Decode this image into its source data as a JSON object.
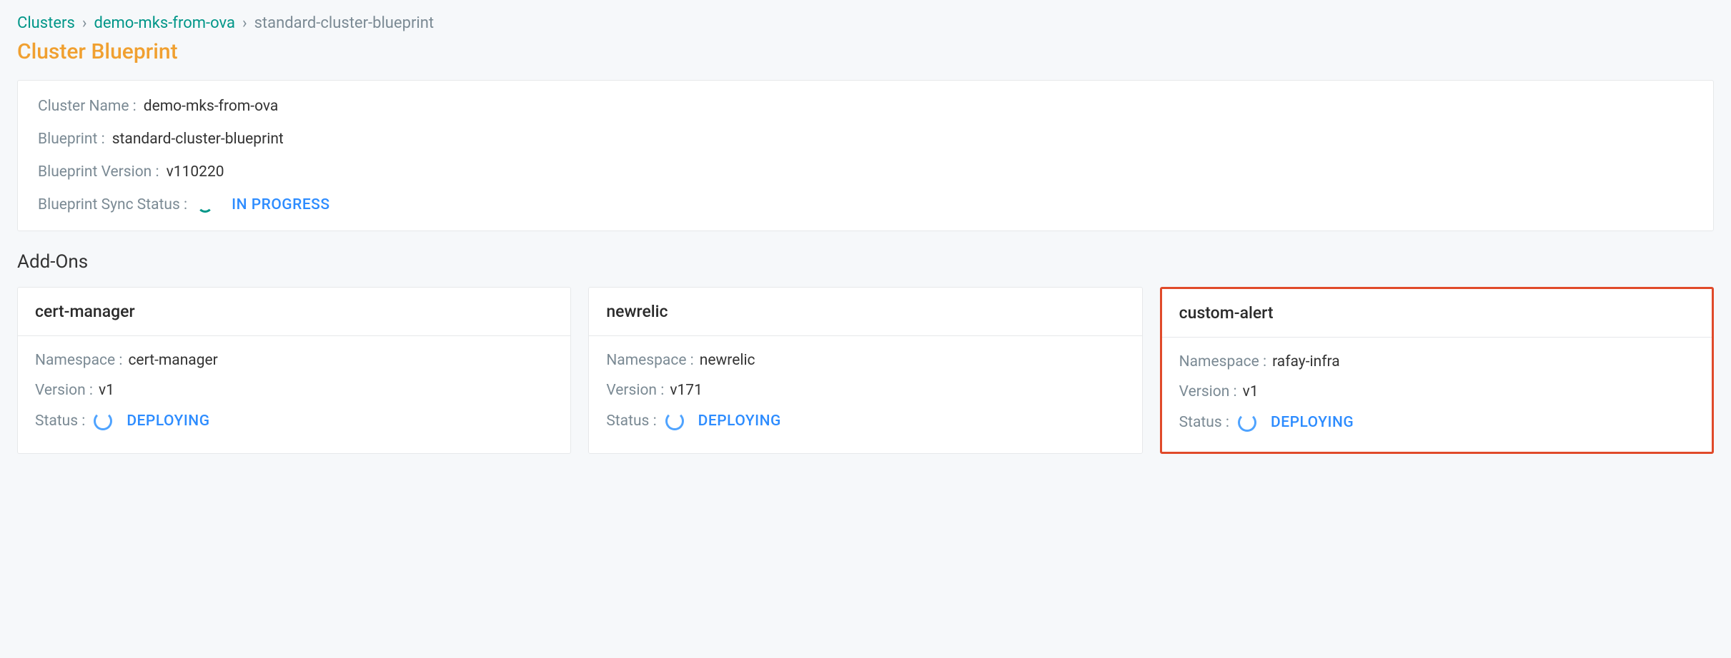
{
  "breadcrumb": {
    "root": "Clusters",
    "cluster": "demo-mks-from-ova",
    "blueprint": "standard-cluster-blueprint",
    "sep": "›"
  },
  "page": {
    "title": "Cluster Blueprint"
  },
  "info": {
    "cluster_name_label": "Cluster Name :",
    "cluster_name": "demo-mks-from-ova",
    "blueprint_label": "Blueprint :",
    "blueprint": "standard-cluster-blueprint",
    "version_label": "Blueprint Version :",
    "version": "v110220",
    "sync_label": "Blueprint Sync Status :",
    "sync_status": "IN PROGRESS"
  },
  "addons": {
    "section_title": "Add-Ons",
    "namespace_label": "Namespace :",
    "version_label": "Version :",
    "status_label": "Status :",
    "items": [
      {
        "name": "cert-manager",
        "namespace": "cert-manager",
        "version": "v1",
        "status": "DEPLOYING",
        "highlight": false
      },
      {
        "name": "newrelic",
        "namespace": "newrelic",
        "version": "v171",
        "status": "DEPLOYING",
        "highlight": false
      },
      {
        "name": "custom-alert",
        "namespace": "rafay-infra",
        "version": "v1",
        "status": "DEPLOYING",
        "highlight": true
      }
    ]
  }
}
